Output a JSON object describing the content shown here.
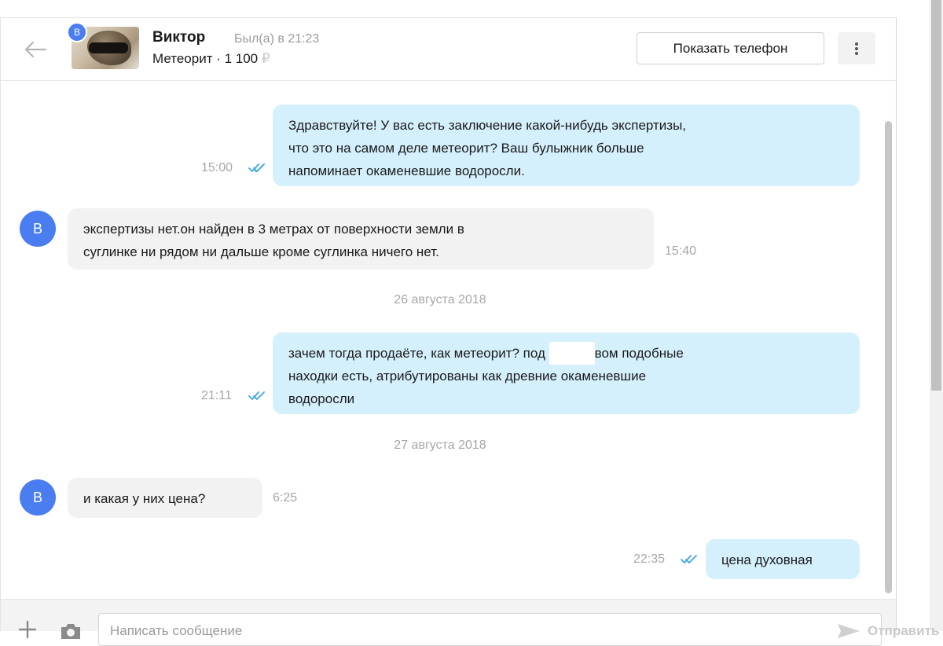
{
  "header": {
    "back_icon": "arrow-left-icon",
    "avatar_badge": "В",
    "contact_name": "Виктор",
    "status": "Был(а) в 21:23",
    "listing": "Метеорит · 1 100",
    "currency": "₽",
    "show_phone_label": "Показать телефон",
    "more_icon": "vertical-dots-icon"
  },
  "messages": [
    {
      "direction": "out",
      "text_lines": [
        "Здравствуйте! У вас есть заключение какой-нибудь экспертизы,",
        "что это на самом деле метеорит? Ваш булыжник больше",
        "напоминает окаменевшие водоросли."
      ],
      "time": "15:00",
      "read": true
    },
    {
      "direction": "in",
      "avatar": "В",
      "text_lines": [
        "экспертизы нет.он найден в 3 метрах от поверхности земли в",
        "суглинке ни рядом ни дальше кроме суглинка ничего нет."
      ],
      "time": "15:40"
    },
    {
      "type": "date",
      "text": "26 августа 2018"
    },
    {
      "direction": "out",
      "text_lines": [
        "зачем тогда продаёте, как метеорит? под",
        "вом подобные",
        "находки есть, атрибутированы как древние окаменевшие",
        "водоросли"
      ],
      "time": "21:11",
      "read": true
    },
    {
      "type": "date",
      "text": "27 августа 2018"
    },
    {
      "direction": "in",
      "avatar": "В",
      "text_lines": [
        "и какая у них цена?"
      ],
      "time": "6:25"
    },
    {
      "direction": "out",
      "text_lines": [
        "цена духовная"
      ],
      "time": "22:35",
      "read": true
    }
  ],
  "composer": {
    "plus_icon": "plus-icon",
    "camera_icon": "camera-icon",
    "placeholder": "Написать сообщение",
    "value": "",
    "send_icon": "paper-plane-icon",
    "send_label": "Отправить"
  },
  "colors": {
    "accent_avatar": "#4a7df0",
    "outgoing_bubble": "#d5f0fd",
    "incoming_bubble": "#f2f2f2",
    "read_ticks": "#3fa4e8"
  }
}
